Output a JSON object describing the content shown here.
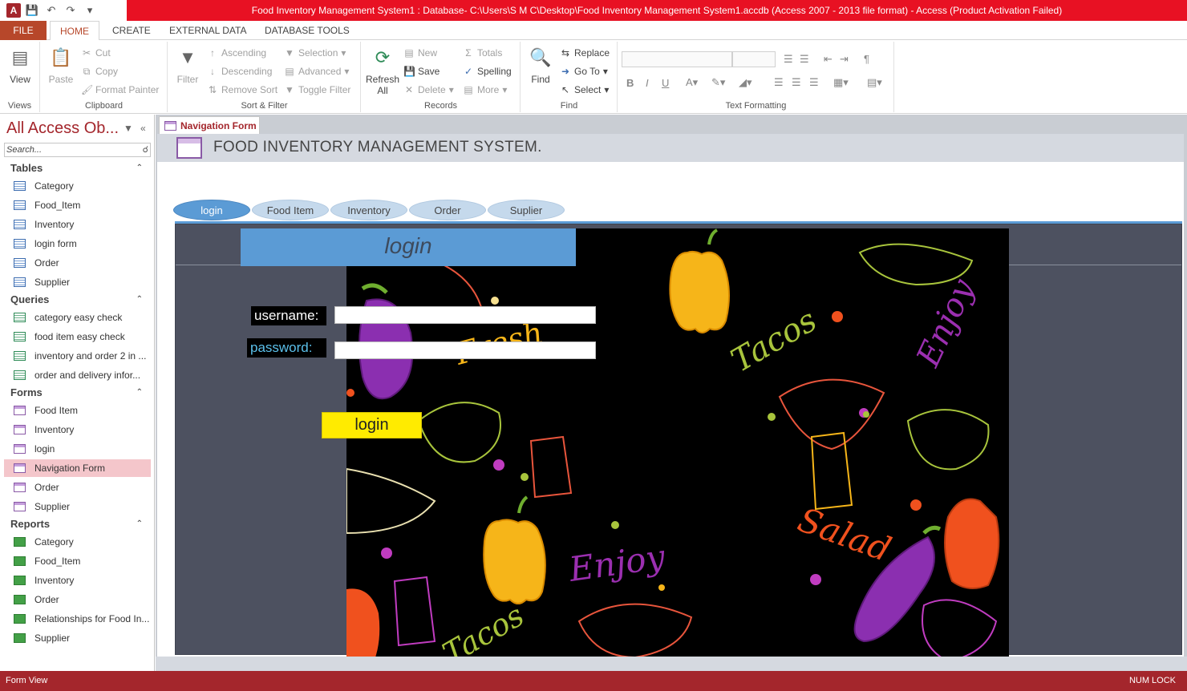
{
  "window": {
    "title": "Food Inventory Management System1 : Database- C:\\Users\\S M C\\Desktop\\Food Inventory Management System1.accdb (Access 2007 - 2013 file format) -  Access (Product Activation Failed)",
    "app_icon": "A"
  },
  "ribbon_tabs": {
    "file": "FILE",
    "tabs": [
      "HOME",
      "CREATE",
      "EXTERNAL DATA",
      "DATABASE TOOLS"
    ]
  },
  "ribbon": {
    "views": {
      "label": "Views",
      "view": "View"
    },
    "clipboard": {
      "label": "Clipboard",
      "paste": "Paste",
      "cut": "Cut",
      "copy": "Copy",
      "format_painter": "Format Painter"
    },
    "sort_filter": {
      "label": "Sort & Filter",
      "filter": "Filter",
      "ascending": "Ascending",
      "descending": "Descending",
      "remove_sort": "Remove Sort",
      "selection": "Selection",
      "advanced": "Advanced",
      "toggle_filter": "Toggle Filter"
    },
    "records": {
      "label": "Records",
      "refresh": "Refresh",
      "refresh_all": "All",
      "new": "New",
      "save": "Save",
      "delete": "Delete",
      "totals": "Totals",
      "spelling": "Spelling",
      "more": "More"
    },
    "find": {
      "label": "Find",
      "find": "Find",
      "replace": "Replace",
      "goto": "Go To",
      "select": "Select"
    },
    "text_formatting": {
      "label": "Text Formatting",
      "bold": "B",
      "italic": "I",
      "underline": "U"
    }
  },
  "nav": {
    "title": "All Access Ob...",
    "search_placeholder": "Search...",
    "sections": [
      {
        "name": "Tables",
        "type": "table",
        "items": [
          "Category",
          "Food_Item",
          "Inventory",
          "login form",
          "Order",
          "Supplier"
        ]
      },
      {
        "name": "Queries",
        "type": "query",
        "items": [
          "category easy check",
          "food item easy check",
          "inventory and order 2 in ...",
          "order and delivery  infor..."
        ]
      },
      {
        "name": "Forms",
        "type": "form",
        "items": [
          "Food Item",
          "Inventory",
          "login",
          "Navigation Form",
          "Order",
          "Supplier"
        ]
      },
      {
        "name": "Reports",
        "type": "report",
        "items": [
          "Category",
          "Food_Item",
          "Inventory",
          "Order",
          "Relationships for Food In...",
          "Supplier"
        ]
      }
    ],
    "selected": "Navigation Form"
  },
  "document": {
    "tab_label": "Navigation Form",
    "header_title": "FOOD INVENTORY MANAGEMENT SYSTEM.",
    "nav_tabs": [
      "login",
      "Food Item",
      "Inventory",
      "Order",
      "Suplier"
    ],
    "active_nav_tab": "login",
    "login_form": {
      "header": "login",
      "username_label": "username:",
      "password_label": "password:",
      "username_value": "",
      "password_value": "",
      "login_button": "login"
    },
    "background_words": [
      "Fresh",
      "Tacos",
      "Enjoy",
      "Salad",
      "Enjoy",
      "Tacos"
    ]
  },
  "status": {
    "left": "Form View",
    "right": "NUM LOCK"
  },
  "colors": {
    "title_red": "#e81123",
    "access_red": "#a4262c",
    "nav_tab_blue": "#5b9bd5",
    "login_yellow": "#ffeb00"
  }
}
